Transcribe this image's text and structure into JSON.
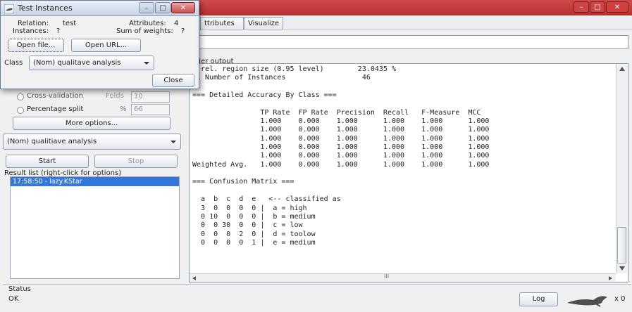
{
  "dialog": {
    "title": "Test Instances",
    "relation_label": "Relation:",
    "relation_value": "test",
    "instances_label": "Instances:",
    "instances_value": "?",
    "attributes_label": "Attributes:",
    "attributes_value": "4",
    "sum_weights_label": "Sum of weights:",
    "sum_weights_value": "?",
    "open_file": "Open file...",
    "open_url": "Open URL...",
    "class_label": "Class",
    "class_value": "(Nom) qualitave analysis",
    "close": "Close"
  },
  "tabs": [
    "ttributes",
    "Visualize"
  ],
  "left": {
    "cross_validation": "Cross-validation",
    "folds_label": "Folds",
    "folds_value": "10",
    "percentage_split": "Percentage split",
    "percent_symbol": "%",
    "percent_value": "66",
    "more_options": "More options...",
    "class_select": "(Nom) qualitiave analysis",
    "start": "Start",
    "stop": "Stop",
    "result_list_label": "Result list (right-click for options)",
    "result_items": [
      "17:58:50 - lazy.KStar"
    ]
  },
  "output": {
    "label": "ifier output",
    "lines": [
      "n rel. region size (0.95 level)        23.0435 %",
      "al Number of Instances                  46",
      "",
      "=== Detailed Accuracy By Class ===",
      "",
      "                TP Rate  FP Rate  Precision  Recall   F-Measure  MCC",
      "                1.000    0.000    1.000      1.000    1.000      1.000",
      "                1.000    0.000    1.000      1.000    1.000      1.000",
      "                1.000    0.000    1.000      1.000    1.000      1.000",
      "                1.000    0.000    1.000      1.000    1.000      1.000",
      "                1.000    0.000    1.000      1.000    1.000      1.000",
      "Weighted Avg.   1.000    0.000    1.000      1.000    1.000      1.000",
      "",
      "=== Confusion Matrix ===",
      "",
      "  a  b  c  d  e   <-- classified as",
      "  3  0  0  0  0 |  a = high",
      "  0 10  0  0  0 |  b = medium",
      "  0  0 30  0  0 |  c = low",
      "  0  0  0  2  0 |  d = toolow",
      "  0  0  0  0  1 |  e = medium"
    ],
    "hscroll_mark": "III"
  },
  "status": {
    "label": "Status",
    "value": "OK",
    "log": "Log",
    "count": "x 0"
  },
  "icons": {
    "dialog_app": "weka-bird-icon",
    "scroll_up": "arrow-up-icon",
    "scroll_down": "arrow-down-icon",
    "scroll_left": "arrow-left-icon",
    "scroll_right": "arrow-right-icon",
    "status_bird": "weka-bird-icon"
  },
  "colors": {
    "main_titlebar": "#c0393b",
    "selection": "#3476d9"
  }
}
